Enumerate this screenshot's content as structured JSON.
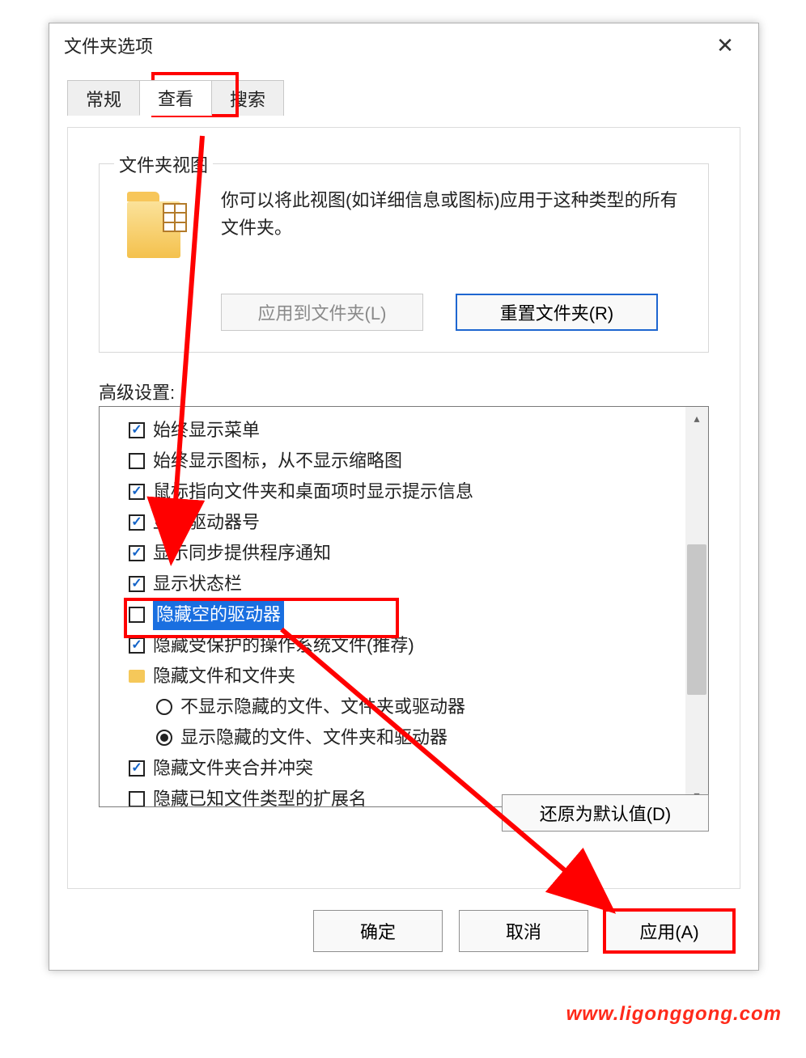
{
  "dialog": {
    "title": "文件夹选项"
  },
  "tabs": {
    "general": "常规",
    "view": "查看",
    "search": "搜索"
  },
  "group": {
    "label": "文件夹视图",
    "desc": "你可以将此视图(如详细信息或图标)应用于这种类型的所有文件夹。",
    "apply_to_folders": "应用到文件夹(L)",
    "reset_folders": "重置文件夹(R)"
  },
  "advanced": {
    "label": "高级设置:",
    "items": [
      {
        "type": "checkbox",
        "checked": true,
        "label": "始终显示菜单"
      },
      {
        "type": "checkbox",
        "checked": false,
        "label": "始终显示图标，从不显示缩略图"
      },
      {
        "type": "checkbox",
        "checked": true,
        "label": "鼠标指向文件夹和桌面项时显示提示信息"
      },
      {
        "type": "checkbox",
        "checked": true,
        "label": "显示驱动器号"
      },
      {
        "type": "checkbox",
        "checked": true,
        "label": "显示同步提供程序通知"
      },
      {
        "type": "checkbox",
        "checked": true,
        "label": "显示状态栏"
      },
      {
        "type": "checkbox",
        "checked": false,
        "label": "隐藏空的驱动器",
        "selected": true
      },
      {
        "type": "checkbox",
        "checked": true,
        "label": "隐藏受保护的操作系统文件(推荐)"
      },
      {
        "type": "folder",
        "label": "隐藏文件和文件夹"
      },
      {
        "type": "radio",
        "checked": false,
        "indent": 1,
        "label": "不显示隐藏的文件、文件夹或驱动器"
      },
      {
        "type": "radio",
        "checked": true,
        "indent": 1,
        "label": "显示隐藏的文件、文件夹和驱动器"
      },
      {
        "type": "checkbox",
        "checked": true,
        "label": "隐藏文件夹合并冲突"
      },
      {
        "type": "checkbox",
        "checked": false,
        "label": "隐藏已知文件类型的扩展名"
      }
    ]
  },
  "buttons": {
    "restore_defaults": "还原为默认值(D)",
    "ok": "确定",
    "cancel": "取消",
    "apply": "应用(A)"
  },
  "watermark": "www.ligonggong.com"
}
